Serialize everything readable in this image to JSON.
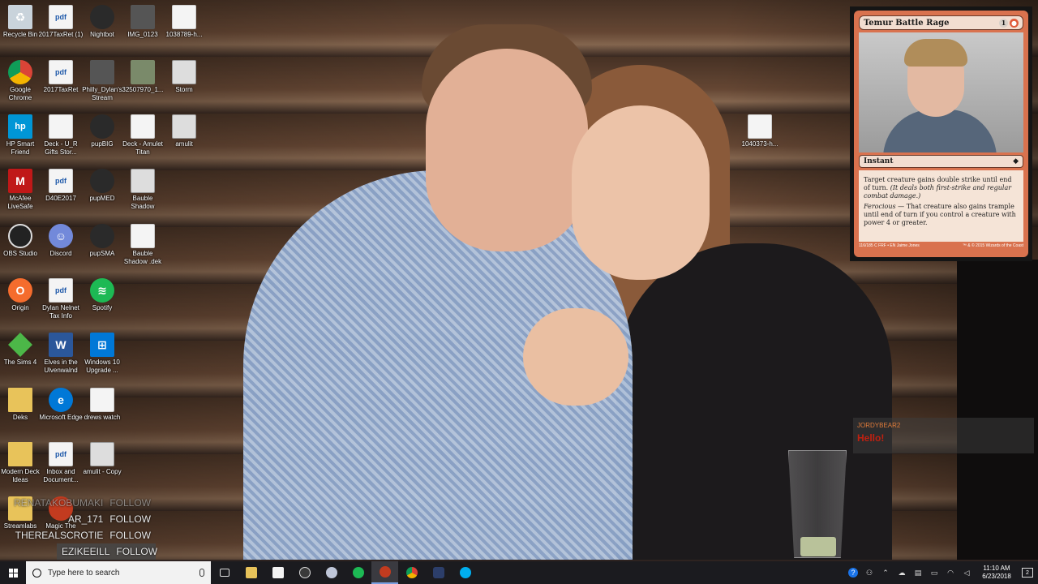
{
  "desktop_icons": [
    {
      "label": "Recycle Bin",
      "icon": "recycle-bin-icon"
    },
    {
      "label": "2017TaxRet (1)",
      "icon": "pdf-icon"
    },
    {
      "label": "Nightbot",
      "icon": "nightbot-icon"
    },
    {
      "label": "IMG_0123",
      "icon": "image-icon"
    },
    {
      "label": "1038789-h...",
      "icon": "file-icon"
    },
    {
      "label": "Google Chrome",
      "icon": "chrome-icon"
    },
    {
      "label": "2017TaxRet",
      "icon": "pdf-icon"
    },
    {
      "label": "Philly_Dylan's Stream",
      "icon": "image-icon"
    },
    {
      "label": "32507970_1...",
      "icon": "image-icon"
    },
    {
      "label": "Storm",
      "icon": "image-icon"
    },
    {
      "label": "HP Smart Friend",
      "icon": "hp-icon"
    },
    {
      "label": "Deck - U_R Gifts Stor...",
      "icon": "file-icon"
    },
    {
      "label": "pupBIG",
      "icon": "dog-icon"
    },
    {
      "label": "Deck - Amulet Titan",
      "icon": "file-icon"
    },
    {
      "label": "amulit",
      "icon": "image-icon"
    },
    {
      "label": "McAfee LiveSafe",
      "icon": "mcafee-icon"
    },
    {
      "label": "D40E2017",
      "icon": "pdf-icon"
    },
    {
      "label": "pupMED",
      "icon": "dog-icon"
    },
    {
      "label": "Bauble Shadow",
      "icon": "image-icon"
    },
    {
      "label": "OBS Studio",
      "icon": "obs-icon"
    },
    {
      "label": "Discord",
      "icon": "discord-icon"
    },
    {
      "label": "pupSMA",
      "icon": "dog-icon"
    },
    {
      "label": "Bauble Shadow .dek",
      "icon": "file-icon"
    },
    {
      "label": "Origin",
      "icon": "origin-icon"
    },
    {
      "label": "Dylan Nelnet Tax Info",
      "icon": "pdf-icon"
    },
    {
      "label": "Spotify",
      "icon": "spotify-icon"
    },
    {
      "label": "The Sims 4",
      "icon": "sims-icon"
    },
    {
      "label": "Elves in the Ulvenwalnd",
      "icon": "word-icon"
    },
    {
      "label": "Windows 10 Upgrade ...",
      "icon": "windows-icon"
    },
    {
      "label": "Deks",
      "icon": "folder-icon"
    },
    {
      "label": "Microsoft Edge",
      "icon": "edge-icon"
    },
    {
      "label": "drews watch",
      "icon": "image-icon"
    },
    {
      "label": "Modern Deck Ideas",
      "icon": "folder-icon"
    },
    {
      "label": "Inbox and Document...",
      "icon": "pdf-icon"
    },
    {
      "label": "amulit - Copy",
      "icon": "image-icon"
    },
    {
      "label": "Streamlabs",
      "icon": "folder-icon"
    },
    {
      "label": "Magic The",
      "icon": "magic-icon"
    },
    {
      "label": "1040373-h...",
      "icon": "file-icon"
    }
  ],
  "card": {
    "name": "Temur Battle Rage",
    "cost_generic": "1",
    "cost_red": "●",
    "type": "Instant",
    "rules_1_plain": "Target creature gains double strike until end of turn.",
    "rules_1_italic": "(It deals both first-strike and regular combat damage.)",
    "rules_2_keyword": "Ferocious",
    "rules_2_text": "— That creature also gains trample until end of turn if you control a creature with power 4 or greater.",
    "collector": "116/185 C",
    "set": "FRF • EN",
    "artist": "Jaime Jones",
    "copyright": "™ & © 2015 Wizards of the Coast"
  },
  "chat": {
    "username": "JORDYBEAR2",
    "message": "Hello!"
  },
  "follows": [
    {
      "name": "RENATAKOBUMAKI",
      "action": "FOLLOW"
    },
    {
      "name": "AR_171",
      "action": "FOLLOW"
    },
    {
      "name": "THEREALSCROTIE",
      "action": "FOLLOW"
    },
    {
      "name": "EZIKEEILL",
      "action": "FOLLOW"
    }
  ],
  "taskbar": {
    "search_placeholder": "Type here to search",
    "time": "11:10 AM",
    "date": "6/23/2018",
    "notification_count": "2",
    "apps": [
      "task-view-icon",
      "file-explorer-icon",
      "store-icon",
      "steam-icon",
      "app-icon",
      "spotify-icon",
      "magic-icon",
      "chrome-icon",
      "nightbot-icon",
      "skype-icon"
    ]
  },
  "colors": {
    "taskbar": "#1b1b1f",
    "card_red": "#d9724e",
    "chat_username": "#e07b3a",
    "chat_message": "#c02010"
  }
}
